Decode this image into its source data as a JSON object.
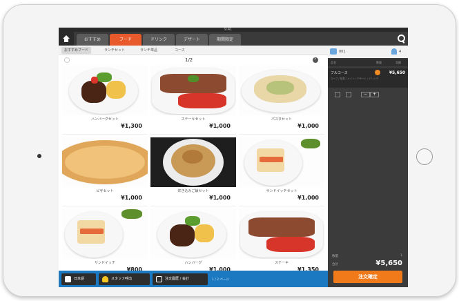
{
  "status": {
    "time": "9:41"
  },
  "tabs": [
    {
      "label": "おすすめ"
    },
    {
      "label": "フード"
    },
    {
      "label": "ドリンク"
    },
    {
      "label": "デザート"
    },
    {
      "label": "期間限定"
    }
  ],
  "subtabs": [
    {
      "label": "おすすめフード"
    },
    {
      "label": "ランチセット"
    },
    {
      "label": "ランチ単品"
    },
    {
      "label": "コース"
    }
  ],
  "pager": {
    "text": "1/2"
  },
  "menu_items": [
    {
      "name": "ハンバーグセット",
      "price": "¥1,300"
    },
    {
      "name": "ステーキセット",
      "price": "¥1,000"
    },
    {
      "name": "パスタセット",
      "price": "¥1,000"
    },
    {
      "name": "ピザセット",
      "price": "¥1,000"
    },
    {
      "name": "炊き込みご飯セット",
      "price": "¥1,000"
    },
    {
      "name": "サンドイッチセット",
      "price": "¥1,000"
    },
    {
      "name": "サンドイッチ",
      "price": "¥800"
    },
    {
      "name": "ハンバーグ",
      "price": "¥1,000"
    },
    {
      "name": "ステーキ",
      "price": "¥1,350"
    }
  ],
  "bottom_bar": {
    "lang": "日本語",
    "staff": "スタッフ呼出",
    "history": "注文履歴 / 会計",
    "page_indicator": "1 / 2 ページ"
  },
  "order_panel": {
    "table": "001",
    "guests": "4",
    "head_name": "品名",
    "head_qty": "数量",
    "head_price": "金額",
    "item_name": "フルコース",
    "item_qty": "1",
    "item_price": "¥5,650",
    "item_note": "スープ / 前菜 / メイン / デザート / ドリンク",
    "subtotal_label": "数量",
    "subtotal_value": "1",
    "total_label": "合計",
    "total_value": "¥5,650",
    "confirm_label": "注文確定"
  },
  "colors": {
    "accent": "#e85a2c",
    "confirm": "#f07a1a",
    "bottom_bar": "#1b79c2"
  }
}
